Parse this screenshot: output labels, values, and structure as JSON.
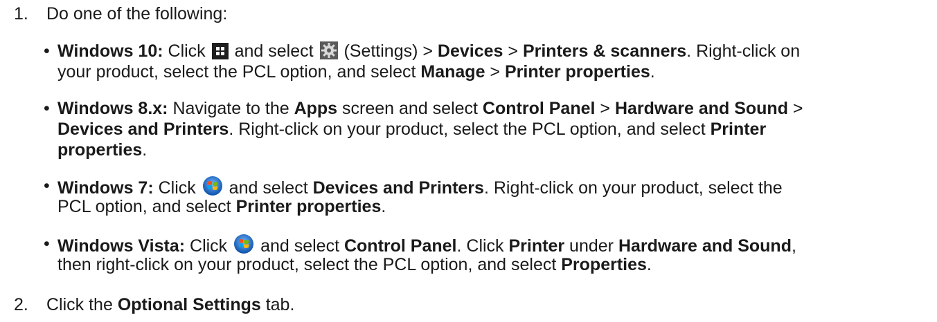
{
  "steps": [
    {
      "number": "1.",
      "text": "Do one of the following:"
    },
    {
      "number": "2.",
      "text_before": "Click the ",
      "bold": "Optional Settings",
      "text_after": " tab."
    }
  ],
  "bullets": {
    "w10": {
      "label": "Windows 10:",
      "l1_click": " Click ",
      "l1_and_select": " and select ",
      "l1_settings": " (Settings) > ",
      "devices": "Devices",
      "gt": " > ",
      "printers_scanners": "Printers & scanners",
      "l1_tail": ". Right-click on",
      "l2_pre": "your product, select the PCL option, and select ",
      "manage": "Manage",
      "printer_properties": "Printer properties",
      "period": ".",
      "start_icon": "windows-10-start-icon",
      "settings_icon": "settings-gear-icon"
    },
    "w8": {
      "label": "Windows 8.x:",
      "l1_nav": " Navigate to the ",
      "apps": "Apps",
      "l1_screen": " screen and select ",
      "control_panel": "Control Panel",
      "gt": " > ",
      "hardware_sound": "Hardware and Sound",
      "gt_end": " >",
      "devices_printers": "Devices and Printers",
      "l2_mid": ". Right-click on your product, select the PCL option, and select ",
      "printer": "Printer",
      "properties": "properties",
      "period": "."
    },
    "w7": {
      "label": "Windows 7:",
      "click": " Click ",
      "and_select": " and select ",
      "devices_printers": "Devices and Printers",
      "l1_tail": ". Right-click on your product, select the",
      "l2_pre": "PCL option, and select ",
      "printer_properties": "Printer properties",
      "period": ".",
      "start_icon": "windows-7-start-orb-icon"
    },
    "vista": {
      "label": "Windows Vista:",
      "click": " Click ",
      "and_select": " and select ",
      "control_panel": "Control Panel",
      "click2": ". Click ",
      "printer": "Printer",
      "under": " under ",
      "hardware_sound": "Hardware and Sound",
      "comma": ",",
      "l2_pre": "then right-click on your product, select the PCL option, and select ",
      "properties": "Properties",
      "period": ".",
      "start_icon": "windows-vista-start-orb-icon"
    }
  },
  "colors": {
    "text": "#1a1a1a",
    "win10_icon": "#1e1e1e",
    "orb_blue": "#1f6fd1"
  }
}
